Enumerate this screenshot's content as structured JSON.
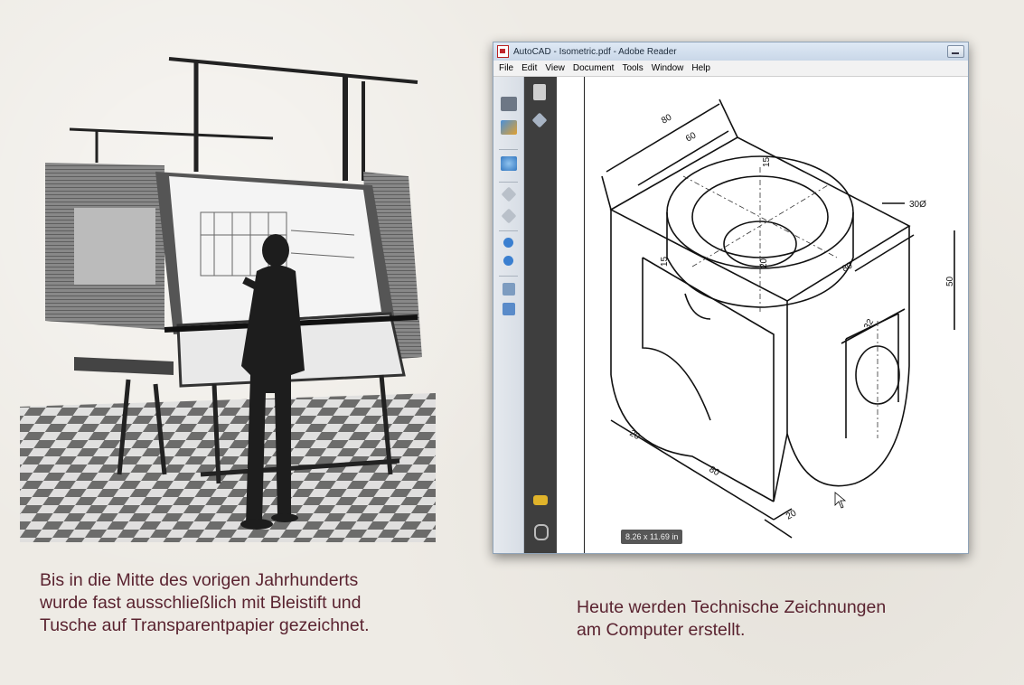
{
  "captions": {
    "left": [
      "Bis in die Mitte des vorigen Jahrhunderts",
      "wurde fast ausschließlich mit Bleistift und",
      "Tusche auf Transparentpapier gezeichnet."
    ],
    "right": [
      "Heute werden Technische Zeichnungen",
      "am Computer erstellt."
    ]
  },
  "window": {
    "title": "AutoCAD - Isometric.pdf - Adobe Reader",
    "menu": [
      "File",
      "Edit",
      "View",
      "Document",
      "Tools",
      "Window",
      "Help"
    ],
    "page_size": "8.26 x 11.69 in"
  },
  "drawing": {
    "dims": {
      "d80_top": "80",
      "d60_top": "60",
      "d15_top": "15",
      "d30_dia": "30Ø",
      "d20_mid": "20",
      "d80_right": "80",
      "d50": "50",
      "d15_left": "15",
      "d32": "32",
      "d20_bottom_left": "20",
      "d80_bottom": "80",
      "d20_bottom_right": "20"
    }
  },
  "colors": {
    "caption": "#5a2330",
    "background": "#eeebe5",
    "nav_panel": "#3e3e3e"
  }
}
